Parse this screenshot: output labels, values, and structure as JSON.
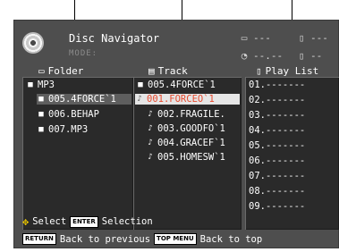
{
  "header": {
    "title": "Disc Navigator",
    "mode": "MODE:",
    "folder_count": "---",
    "track_count": "---",
    "time": "--.--",
    "playlist_count": "--"
  },
  "folder_panel": {
    "heading": "Folder",
    "items": [
      {
        "label": "MP3"
      },
      {
        "label": "005.4FORCE`1"
      },
      {
        "label": "006.BEHAP"
      },
      {
        "label": "007.MP3"
      }
    ]
  },
  "track_panel": {
    "heading": "Track",
    "items": [
      {
        "label": "005.4FORCE`1"
      },
      {
        "label": "001.FORCEO`1"
      },
      {
        "label": "002.FRAGILE."
      },
      {
        "label": "003.GOODFO`1"
      },
      {
        "label": "004.GRACEF`1"
      },
      {
        "label": "005.HOMESW`1"
      }
    ]
  },
  "playlist_panel": {
    "heading": "Play List",
    "items": [
      {
        "label": "01.-------"
      },
      {
        "label": "02.-------"
      },
      {
        "label": "03.-------"
      },
      {
        "label": "04.-------"
      },
      {
        "label": "05.-------"
      },
      {
        "label": "06.-------"
      },
      {
        "label": "07.-------"
      },
      {
        "label": "08.-------"
      },
      {
        "label": "09.-------"
      }
    ]
  },
  "footer": {
    "select_label": "Select",
    "enter_key": "ENTER",
    "selection_label": "Selection",
    "return_key": "RETURN",
    "back_label": "Back to previous",
    "topmenu_key": "TOP MENU",
    "top_label": "Back to top"
  },
  "colors": {
    "screen_bg": "#4e4e4e",
    "panel_bg": "#2a2a2a",
    "highlight_bg": "#e6e6e6",
    "highlight_text": "#e64a2e",
    "dpad": "#e7c400"
  }
}
